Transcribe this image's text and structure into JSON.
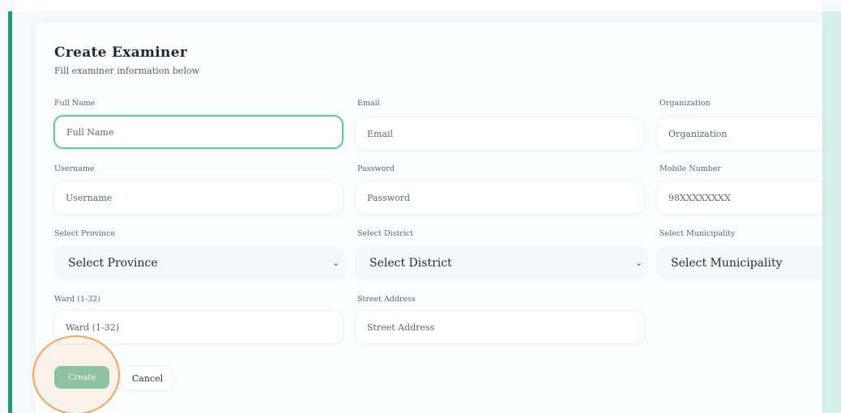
{
  "form": {
    "title": "Create Examiner",
    "subtitle": "Fill examiner information below",
    "full_name": {
      "label": "Full Name",
      "placeholder": "Full Name"
    },
    "email": {
      "label": "Email",
      "placeholder": "Email"
    },
    "organization": {
      "label": "Organization",
      "placeholder": "Organization"
    },
    "username": {
      "label": "Username",
      "placeholder": "Username"
    },
    "password": {
      "label": "Password",
      "placeholder": "Password"
    },
    "mobile": {
      "label": "Mobile Number",
      "placeholder": "98XXXXXXXX"
    },
    "province": {
      "label": "Select Province",
      "value": "Select Province"
    },
    "district": {
      "label": "Select District",
      "value": "Select District"
    },
    "municipality": {
      "label": "Select Municipality",
      "value": "Select Municipality"
    },
    "ward": {
      "label": "Ward (1-32)",
      "placeholder": "Ward (1-32)"
    },
    "street": {
      "label": "Street Address",
      "placeholder": "Street Address"
    },
    "create_label": "Create",
    "cancel_label": "Cancel"
  },
  "theme": {
    "accent": "#1f9d6c",
    "button": "#7ec7ac",
    "focus": "#6cc3a2",
    "highlight": "#f3a35a"
  }
}
